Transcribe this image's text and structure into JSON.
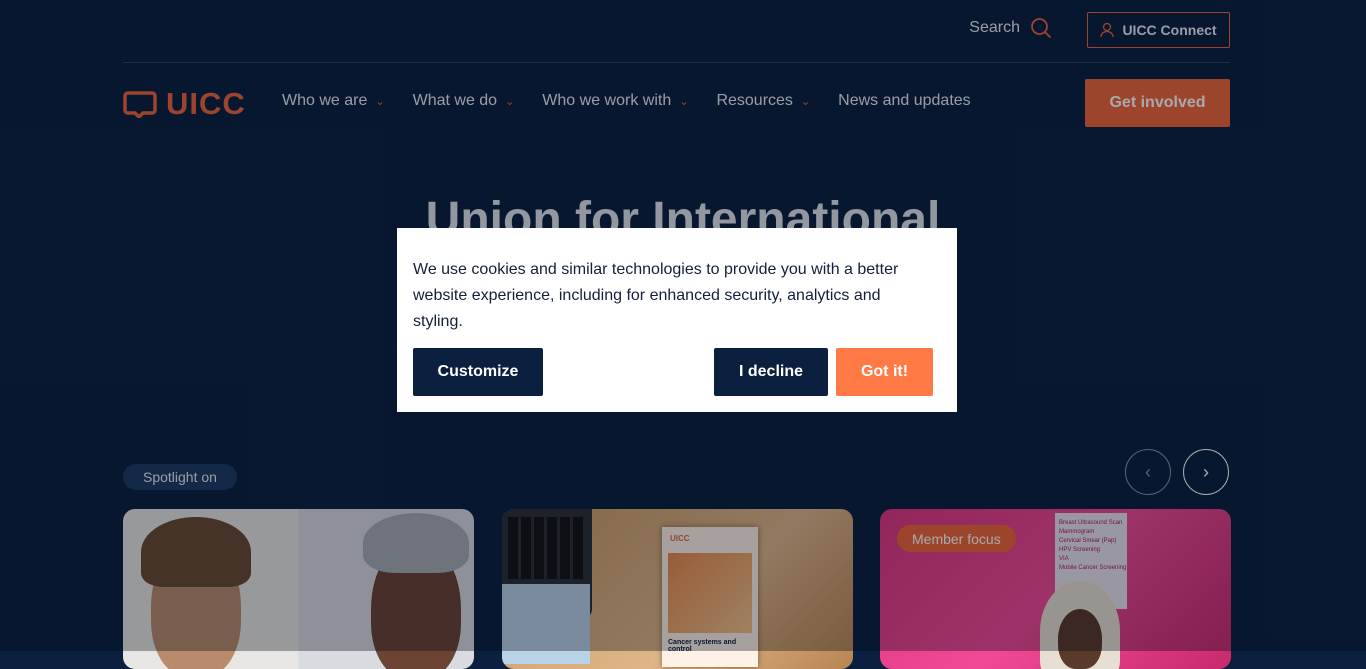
{
  "header": {
    "search_label": "Search",
    "connect_label": "UICC Connect"
  },
  "nav": {
    "logo_text": "UICC",
    "items": [
      {
        "label": "Who we are",
        "has_dropdown": true
      },
      {
        "label": "What we do",
        "has_dropdown": true
      },
      {
        "label": "Who we work with",
        "has_dropdown": true
      },
      {
        "label": "Resources",
        "has_dropdown": true
      },
      {
        "label": "News and updates",
        "has_dropdown": false
      }
    ],
    "cta_label": "Get involved"
  },
  "hero": {
    "title": "Union for International"
  },
  "spotlight": {
    "label": "Spotlight on",
    "cards": [
      {
        "badge": ""
      },
      {
        "badge": "",
        "book_logo": "UICC",
        "book_title": "Cancer systems and control"
      },
      {
        "badge": "Member focus",
        "banner_text": "Breast Ultrasound Scan\nMammogram\nCervical Smear (Pap)\nHPV Screening\nVIA\nMobile Cancer Screening"
      }
    ]
  },
  "cookie_banner": {
    "message": "We use cookies and similar technologies to provide you with a better website experience, including for enhanced security, analytics and styling.",
    "customize_label": "Customize",
    "decline_label": "I decline",
    "accept_label": "Got it!"
  },
  "colors": {
    "background": "#0b1f3f",
    "accent": "#f0663a",
    "accept_button": "#ff7a45"
  }
}
